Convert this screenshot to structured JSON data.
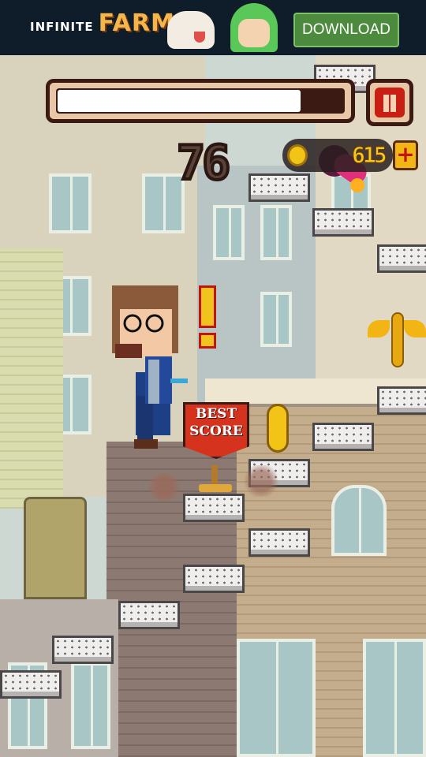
{
  "ad": {
    "title_small": "INFINITE",
    "title_big": "FARM",
    "download_label": "DOWNLOAD"
  },
  "hud": {
    "progress_fraction": 0.85,
    "score": "76",
    "coins": "615",
    "plus_label": "+"
  },
  "sign": {
    "line1": "BEST",
    "line2": "SCORE"
  },
  "icons": {
    "pause": "pause-icon",
    "coin": "coin-icon",
    "candy": "candy-icon",
    "winged_coin": "winged-coin-icon",
    "exclamation": "exclamation-icon"
  },
  "colors": {
    "hud_frame": "#3a1a12",
    "pause_red": "#c81e14",
    "coin_gold": "#f2c418",
    "sign_red": "#d6331f",
    "ad_green": "#4c8a3e"
  }
}
